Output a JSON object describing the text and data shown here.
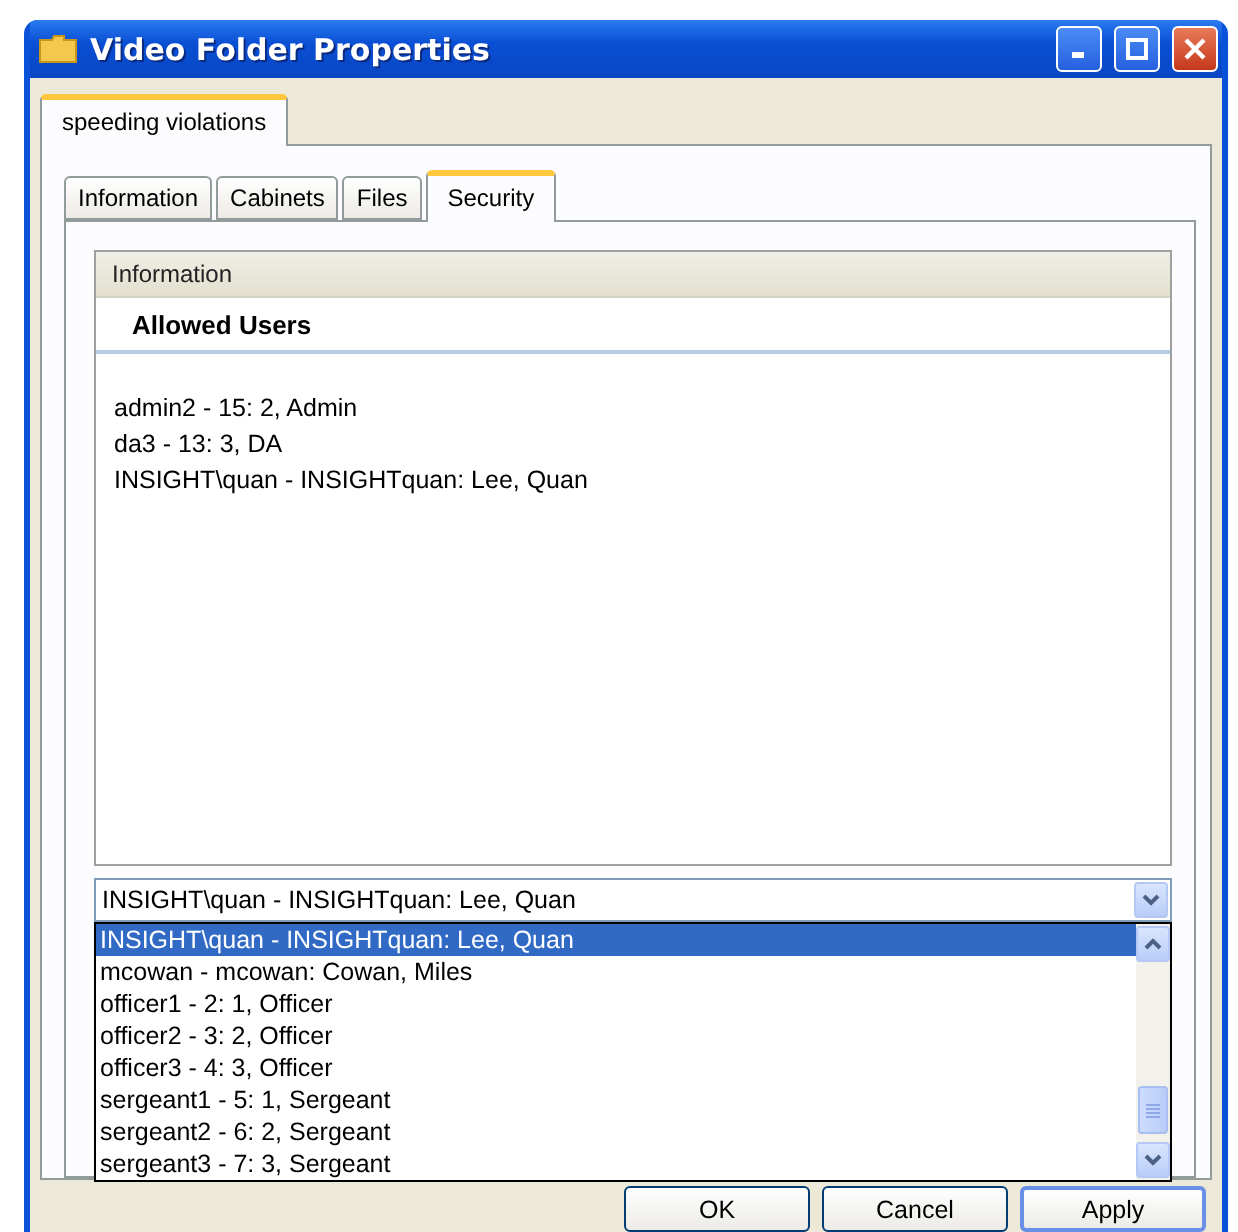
{
  "window": {
    "title": "Video Folder Properties"
  },
  "outer_tabs": [
    {
      "label": "speeding violations",
      "selected": true
    }
  ],
  "inner_tabs": [
    {
      "label": "Information",
      "selected": false
    },
    {
      "label": "Cabinets",
      "selected": false
    },
    {
      "label": "Files",
      "selected": false
    },
    {
      "label": "Security",
      "selected": true
    }
  ],
  "info_panel": {
    "header": "Information",
    "section_title": "Allowed Users",
    "users": [
      "admin2 - 15: 2, Admin",
      "da3 - 13: 3, DA",
      "INSIGHT\\quan - INSIGHTquan: Lee, Quan"
    ]
  },
  "combo": {
    "value": "INSIGHT\\quan - INSIGHTquan: Lee, Quan",
    "expanded": true
  },
  "dropdown": {
    "options": [
      {
        "label": "INSIGHT\\quan - INSIGHTquan: Lee, Quan",
        "selected": true
      },
      {
        "label": "mcowan - mcowan: Cowan, Miles",
        "selected": false
      },
      {
        "label": "officer1 - 2: 1, Officer",
        "selected": false
      },
      {
        "label": "officer2 - 3: 2, Officer",
        "selected": false
      },
      {
        "label": "officer3 - 4: 3, Officer",
        "selected": false
      },
      {
        "label": "sergeant1 - 5: 1, Sergeant",
        "selected": false
      },
      {
        "label": "sergeant2 - 6: 2, Sergeant",
        "selected": false
      },
      {
        "label": "sergeant3 - 7: 3, Sergeant",
        "selected": false
      }
    ]
  },
  "buttons": [
    {
      "label": "OK",
      "focused": false
    },
    {
      "label": "Cancel",
      "focused": false
    },
    {
      "label": "Apply",
      "focused": true
    }
  ]
}
